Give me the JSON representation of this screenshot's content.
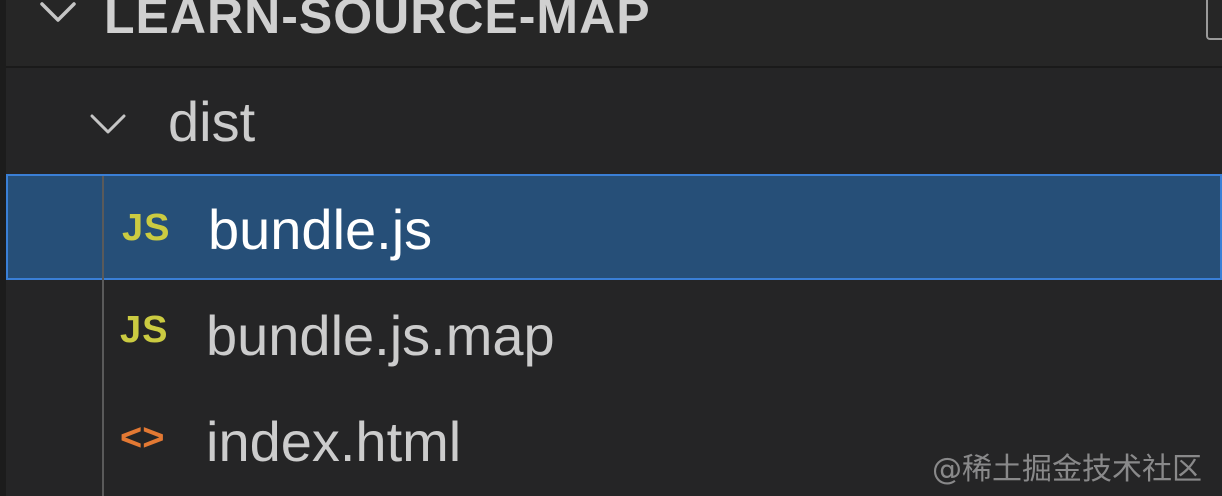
{
  "explorer": {
    "title": "LEARN-SOURCE-MAP",
    "folder": {
      "label": "dist",
      "expanded": true
    },
    "files": [
      {
        "label": "bundle.js",
        "icon_text": "JS",
        "icon": "javascript-file-icon",
        "selected": true
      },
      {
        "label": "bundle.js.map",
        "icon_text": "JS",
        "icon": "javascript-file-icon",
        "selected": false
      },
      {
        "label": "index.html",
        "icon_text": "<>",
        "icon": "html-file-icon",
        "selected": false
      }
    ]
  },
  "watermark": "@稀土掘金技术社区",
  "colors": {
    "background": "#252526",
    "selection": "#264f78",
    "selection_border": "#3a7fd6",
    "js_icon": "#cbcb41",
    "html_icon": "#e37933",
    "text": "#cccccc"
  }
}
